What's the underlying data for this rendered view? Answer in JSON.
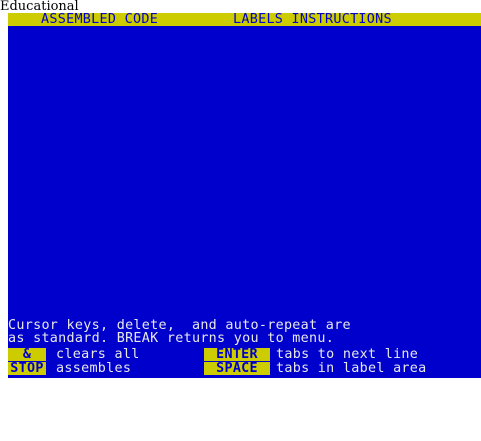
{
  "page_label": "Educational",
  "header": {
    "col1": "ASSEMBLED CODE",
    "col2": "LABELS INSTRUCTIONS"
  },
  "help": {
    "line1": "Cursor keys, delete,  and auto-repeat are",
    "line2": "as standard. BREAK returns you to menu."
  },
  "keys": {
    "stop_top": "&",
    "stop_bottom": "STOP",
    "stop_desc1": "clears all",
    "stop_desc2": "assembles",
    "enter": "ENTER",
    "space": "SPACE",
    "enter_desc": "tabs to next line",
    "space_desc": "tabs in label area"
  },
  "colors": {
    "screen_bg": "#0000cc",
    "header_bg": "#cccc00",
    "text": "#e8e8e8"
  }
}
